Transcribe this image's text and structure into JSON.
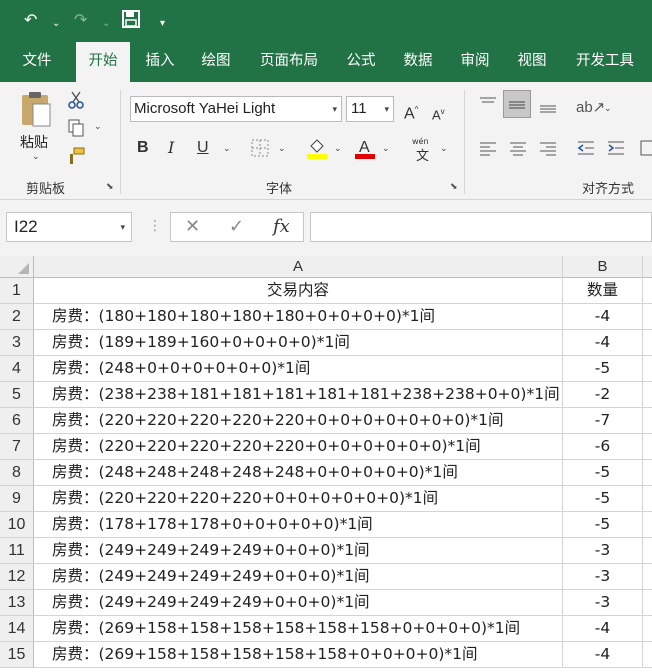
{
  "quick_access": {
    "undo_icon": "undo-icon",
    "redo_icon": "redo-icon",
    "save_icon": "save-icon"
  },
  "tabs": [
    {
      "label": "文件"
    },
    {
      "label": "开始",
      "active": true
    },
    {
      "label": "插入"
    },
    {
      "label": "绘图"
    },
    {
      "label": "页面布局"
    },
    {
      "label": "公式"
    },
    {
      "label": "数据"
    },
    {
      "label": "审阅"
    },
    {
      "label": "视图"
    },
    {
      "label": "开发工具"
    }
  ],
  "ribbon": {
    "clipboard": {
      "paste_label": "粘贴",
      "group_label": "剪贴板"
    },
    "font": {
      "font_name": "Microsoft YaHei Light",
      "font_size": "11",
      "bold": "B",
      "italic": "I",
      "underline": "U",
      "phonetic": "wén",
      "group_label": "字体"
    },
    "alignment": {
      "group_label": "对齐方式"
    }
  },
  "formula_bar": {
    "name_box": "I22",
    "fx_label": "fx",
    "formula": ""
  },
  "sheet": {
    "columns": [
      "A",
      "B"
    ],
    "rows": [
      {
        "num": "1",
        "a": "交易内容",
        "b": "数量"
      },
      {
        "num": "2",
        "a": "房费：(180+180+180+180+180+0+0+0+0)*1间",
        "b": "-4"
      },
      {
        "num": "3",
        "a": "房费：(189+189+160+0+0+0+0)*1间",
        "b": "-4"
      },
      {
        "num": "4",
        "a": "房费：(248+0+0+0+0+0+0)*1间",
        "b": "-5"
      },
      {
        "num": "5",
        "a": "房费：(238+238+181+181+181+181+181+238+238+0+0)*1间",
        "b": "-2"
      },
      {
        "num": "6",
        "a": "房费：(220+220+220+220+220+0+0+0+0+0+0+0)*1间",
        "b": "-7"
      },
      {
        "num": "7",
        "a": "房费：(220+220+220+220+220+0+0+0+0+0+0)*1间",
        "b": "-6"
      },
      {
        "num": "8",
        "a": "房费：(248+248+248+248+248+0+0+0+0+0)*1间",
        "b": "-5"
      },
      {
        "num": "9",
        "a": "房费：(220+220+220+220+0+0+0+0+0+0)*1间",
        "b": "-5"
      },
      {
        "num": "10",
        "a": "房费：(178+178+178+0+0+0+0+0)*1间",
        "b": "-5"
      },
      {
        "num": "11",
        "a": "房费：(249+249+249+249+0+0+0)*1间",
        "b": "-3"
      },
      {
        "num": "12",
        "a": "房费：(249+249+249+249+0+0+0)*1间",
        "b": "-3"
      },
      {
        "num": "13",
        "a": "房费：(249+249+249+249+0+0+0)*1间",
        "b": "-3"
      },
      {
        "num": "14",
        "a": "房费：(269+158+158+158+158+158+158+0+0+0+0)*1间",
        "b": "-4"
      },
      {
        "num": "15",
        "a": "房费：(269+158+158+158+158+158+0+0+0+0)*1间",
        "b": "-4"
      }
    ]
  },
  "colors": {
    "brand": "#217346",
    "fill_highlight": "#ffff00",
    "font_color": "#e00000"
  }
}
